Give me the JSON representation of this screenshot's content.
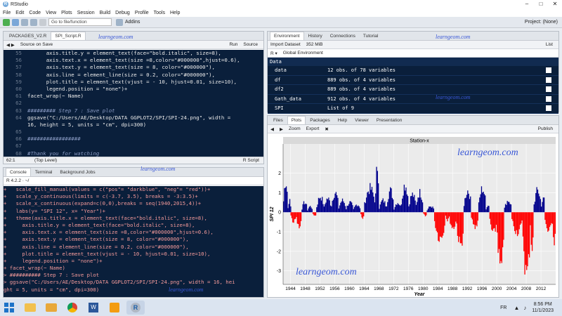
{
  "window": {
    "title": "RStudio",
    "project": "Project: (None)"
  },
  "menu": [
    "File",
    "Edit",
    "Code",
    "View",
    "Plots",
    "Session",
    "Build",
    "Debug",
    "Profile",
    "Tools",
    "Help"
  ],
  "toolbar": {
    "goto": "Go to file/function",
    "addins": "Addins"
  },
  "editor": {
    "tabs": [
      "PACKAGES_V2.R",
      "SPI_Script.R"
    ],
    "source_on_save": "Source on Save",
    "run": "Run",
    "source": "Source",
    "lines": [
      {
        "n": "55",
        "t": "      axis.title.y = element_text(face=\"bold.italic\", size=8),"
      },
      {
        "n": "56",
        "t": "      axis.text.x = element_text(size =8,color=\"#000000\",hjust=0.6),"
      },
      {
        "n": "57",
        "t": "      axis.text.y = element_text(size = 8, color=\"#000000\"),"
      },
      {
        "n": "58",
        "t": "      axis.line = element_line(size = 0.2, color=\"#000000\"),"
      },
      {
        "n": "59",
        "t": "      plot.title = element_text(vjust = - 10, hjust=0.01, size=10),"
      },
      {
        "n": "60",
        "t": "      legend.position = \"none\")+"
      },
      {
        "n": "61",
        "t": "facet_wrap(~ Name)"
      },
      {
        "n": "62",
        "t": ""
      },
      {
        "n": "63",
        "t": "######### Step 7 : Save plot",
        "c": true
      },
      {
        "n": "64",
        "t": "ggsave(\"C:/Users/AE/Desktop/DATA GGPLOT2/SPI/SPI-24.png\", width ="
      },
      {
        "n": "",
        "t": "16, height = 5, units = \"cm\", dpi=300)"
      },
      {
        "n": "65",
        "t": ""
      },
      {
        "n": "66",
        "t": "#################",
        "c": true
      },
      {
        "n": "67",
        "t": ""
      },
      {
        "n": "68",
        "t": "#Thank you for watching",
        "c": true
      },
      {
        "n": "69",
        "t": "# The full script is available on our website : https://www",
        "c": true
      }
    ],
    "status_pos": "62:1",
    "status_level": "(Top Level)",
    "status_lang": "R Script"
  },
  "console": {
    "tabs": [
      "Console",
      "Terminal",
      "Background Jobs"
    ],
    "r_version": "R 4.2.2 · ~/",
    "lines": [
      "+   scale_fill_manual(values = c(\"pos\"= \"darkblue\", \"neg\"= \"red\"))+",
      "+   scale_y_continuous(limits = c(-3.7, 3.5), breaks = -3:3.5)+",
      "+   scale_x_continuous(expand=c(0,0),breaks = seq(1940,2015,4))+",
      "+   labs(y= \"SPI 12\", x= \"Year\")+",
      "+   theme(axis.title.x = element_text(face=\"bold.italic\", size=8),",
      "+     axis.title.y = element_text(face=\"bold.italic\", size=8),",
      "+     axis.text.x = element_text(size =8,color=\"#000000\",hjust=0.6),",
      "+     axis.text.y = element_text(size = 8, color=\"#000000\"),",
      "+     axis.line = element_line(size = 0.2, color=\"#000000\"),",
      "+     plot.title = element_text(vjust = - 10, hjust=0.01, size=10),",
      "+     legend.position = \"none\")+",
      "+ facet_wrap(~ Name)",
      "> ########## Step 7 : Save plot",
      "> ggsave(\"C:/Users/AE/Desktop/DATA GGPLOT2/SPI/SPI-24.png\", width = 16, hei",
      "ght = 5, units = \"cm\", dpi=300)"
    ]
  },
  "environment": {
    "tabs": [
      "Environment",
      "History",
      "Connections",
      "Tutorial"
    ],
    "import": "Import Dataset",
    "memory": "352 MiB",
    "list": "List",
    "scope": "Global Environment",
    "header": "Data",
    "rows": [
      {
        "name": "data",
        "value": "12 obs. of 78 variables"
      },
      {
        "name": "df",
        "value": "889 obs. of 4 variables"
      },
      {
        "name": "df2",
        "value": "889 obs. of 4 variables"
      },
      {
        "name": "Gath_data",
        "value": "912 obs. of 4 variables"
      },
      {
        "name": "SPI",
        "value": "List of  9"
      }
    ]
  },
  "plots": {
    "tabs": [
      "Files",
      "Plots",
      "Packages",
      "Help",
      "Viewer",
      "Presentation"
    ],
    "zoom": "Zoom",
    "export": "Export",
    "publish": "Publish"
  },
  "chart_data": {
    "type": "bar",
    "title": "Station-x",
    "xlabel": "Year",
    "ylabel": "SPI 12",
    "xlim": [
      1942,
      2016
    ],
    "ylim": [
      -3.7,
      3.5
    ],
    "yticks": [
      -3,
      -2,
      -1,
      0,
      1,
      2
    ],
    "xticks": [
      1944,
      1948,
      1952,
      1956,
      1960,
      1964,
      1968,
      1972,
      1976,
      1980,
      1984,
      1988,
      1992,
      1996,
      2000,
      2004,
      2008,
      2012
    ],
    "colors": {
      "pos": "#00008b",
      "neg": "#ff0000"
    },
    "series": [
      {
        "x_start": 1942,
        "step": 0.0833,
        "values": "segments",
        "segments": [
          [
            1942.0,
            1943.2,
            1.6
          ],
          [
            1943.2,
            1944.0,
            0.6
          ],
          [
            1944.0,
            1945.5,
            -0.5
          ],
          [
            1945.5,
            1947.0,
            -0.8
          ],
          [
            1947.0,
            1948.5,
            0.5
          ],
          [
            1948.5,
            1950.0,
            0.3
          ],
          [
            1950.0,
            1951.0,
            -0.2
          ],
          [
            1951.0,
            1953.0,
            0.8
          ],
          [
            1953.0,
            1955.0,
            0.7
          ],
          [
            1955.0,
            1957.0,
            1.0
          ],
          [
            1957.0,
            1959.0,
            0.6
          ],
          [
            1959.0,
            1961.0,
            0.5
          ],
          [
            1961.0,
            1963.0,
            0.4
          ],
          [
            1963.0,
            1964.0,
            -0.3
          ],
          [
            1964.0,
            1967.0,
            1.2
          ],
          [
            1967.0,
            1968.0,
            2.4
          ],
          [
            1968.0,
            1970.0,
            0.6
          ],
          [
            1970.0,
            1972.0,
            1.1
          ],
          [
            1972.0,
            1974.0,
            0.5
          ],
          [
            1974.0,
            1976.0,
            1.4
          ],
          [
            1976.0,
            1978.0,
            0.9
          ],
          [
            1978.0,
            1980.0,
            1.0
          ],
          [
            1980.0,
            1981.0,
            -0.2
          ],
          [
            1981.0,
            1983.0,
            0.3
          ],
          [
            1983.0,
            1986.0,
            -1.3
          ],
          [
            1986.0,
            1987.0,
            -0.4
          ],
          [
            1987.0,
            1989.0,
            -0.8
          ],
          [
            1989.0,
            1991.0,
            -1.7
          ],
          [
            1991.0,
            1993.0,
            1.1
          ],
          [
            1993.0,
            1995.0,
            -0.8
          ],
          [
            1995.0,
            1997.0,
            1.2
          ],
          [
            1997.0,
            1998.0,
            0.4
          ],
          [
            1998.0,
            2000.0,
            -1.1
          ],
          [
            2000.0,
            2002.0,
            -2.9
          ],
          [
            2002.0,
            2004.0,
            0.6
          ],
          [
            2004.0,
            2007.0,
            -1.0
          ],
          [
            2007.0,
            2009.0,
            -3.2
          ],
          [
            2009.0,
            2010.0,
            -1.8
          ],
          [
            2010.0,
            2012.0,
            1.1
          ],
          [
            2012.0,
            2013.0,
            0.8
          ],
          [
            2013.0,
            2015.0,
            -1.0
          ],
          [
            2015.0,
            2016.0,
            -1.4
          ]
        ]
      }
    ]
  },
  "watermark": "learngeom.com",
  "taskbar": {
    "lang": "FR",
    "time": "8:56 PM",
    "date": "11/1/2023"
  }
}
